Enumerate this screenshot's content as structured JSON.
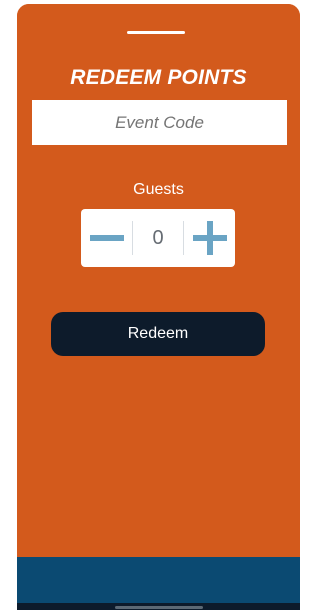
{
  "modal": {
    "title": "REDEEM POINTS",
    "event_code_placeholder": "Event Code",
    "guests_label": "Guests",
    "guests_value": "0",
    "redeem_label": "Redeem"
  },
  "icons": {
    "decrement": "minus-icon",
    "increment": "plus-icon"
  },
  "colors": {
    "background": "#d35a1c",
    "stepper_icon": "#6aa4c4",
    "button": "#0d1b2b",
    "bottom_bar": "#0b4a72"
  }
}
